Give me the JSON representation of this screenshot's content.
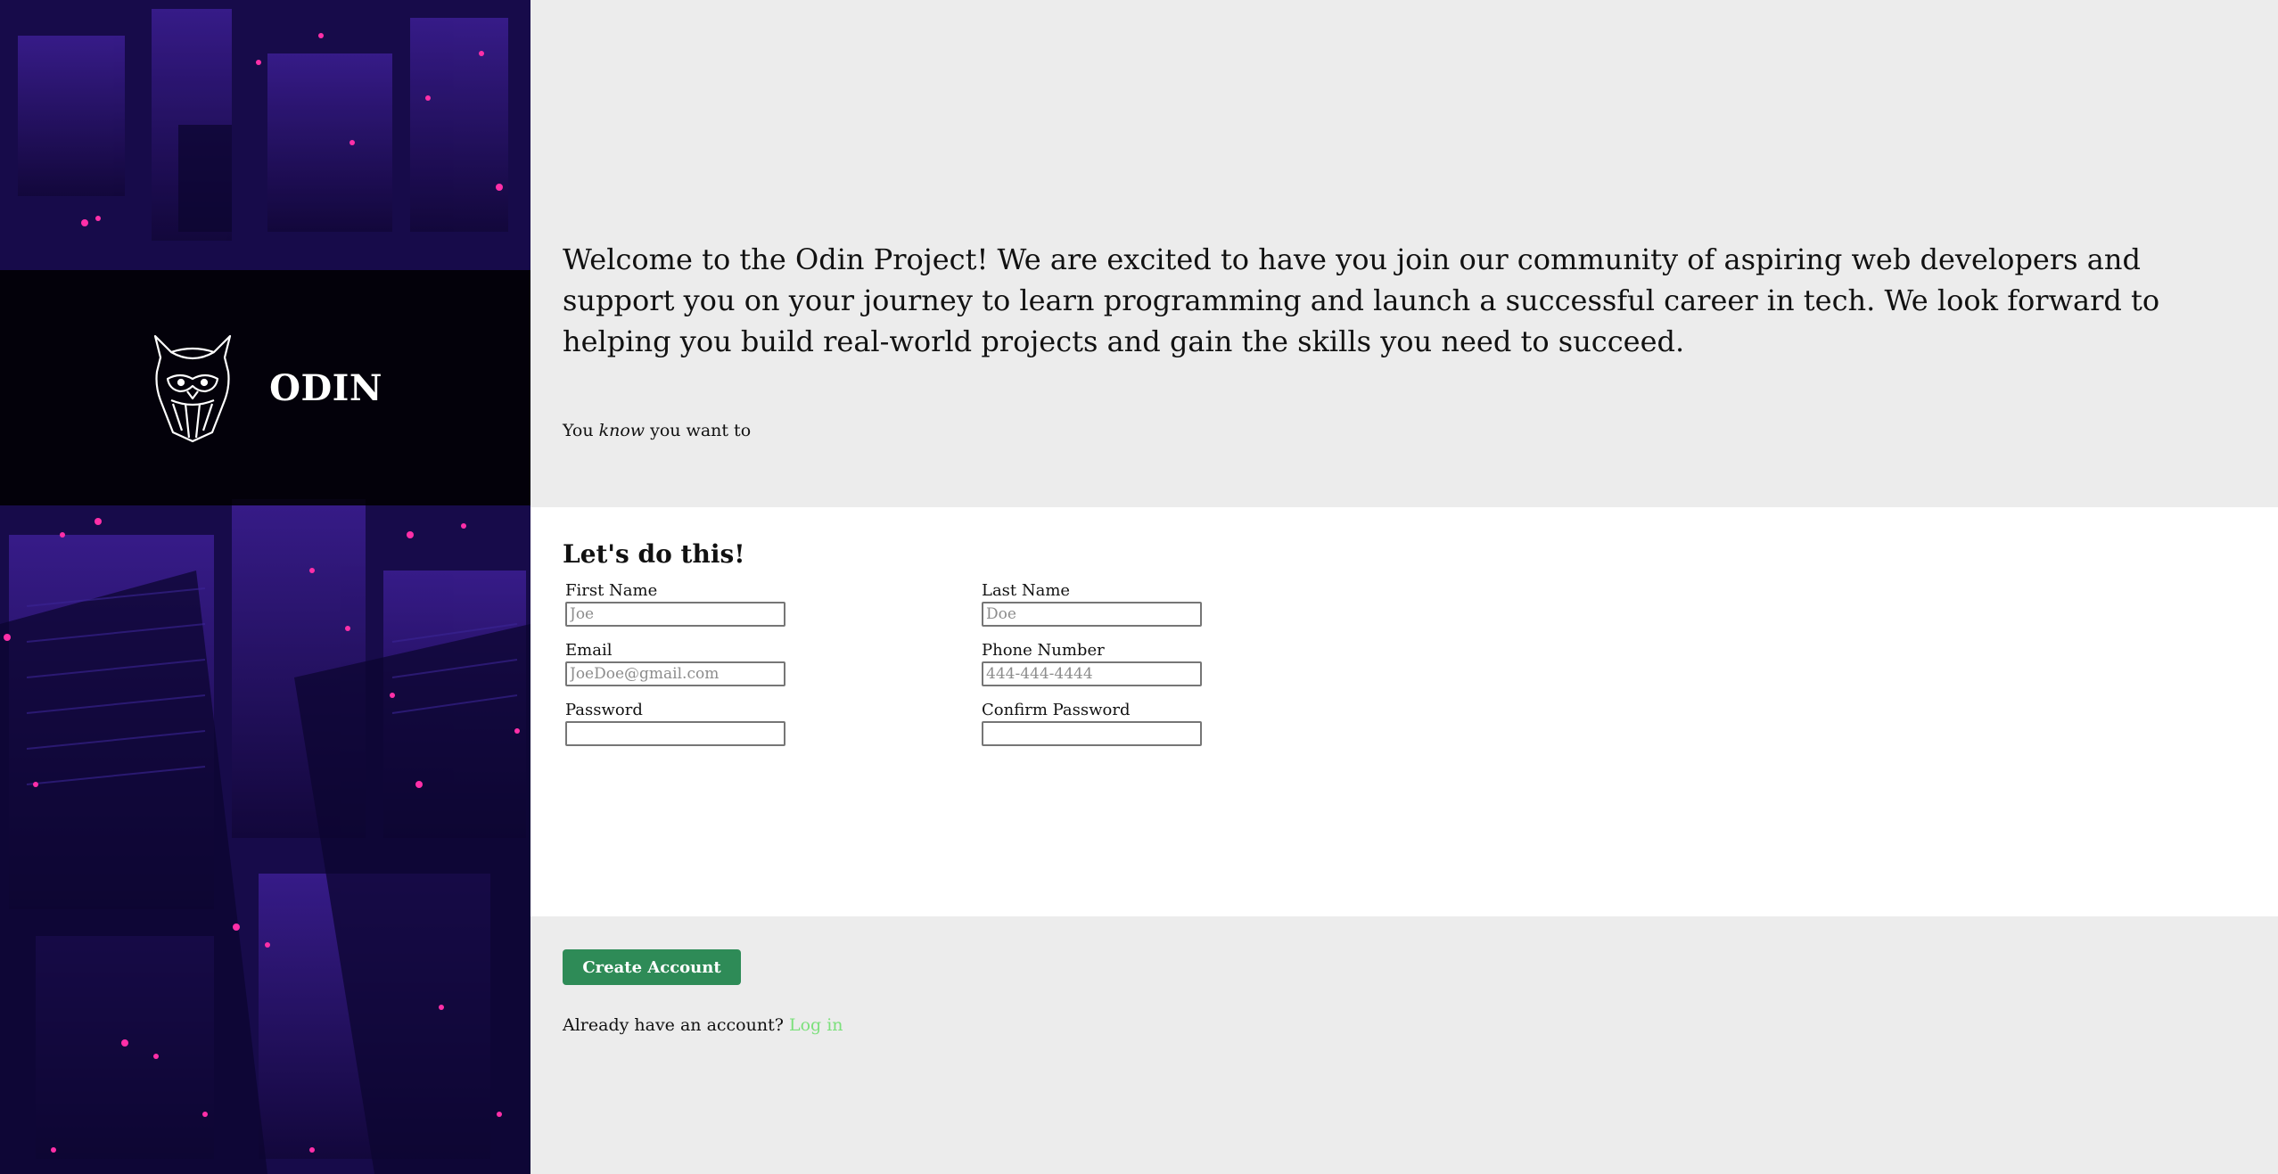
{
  "hero": {
    "brand": "ODIN",
    "logo_icon": "odin-viking-helmet-icon"
  },
  "intro": {
    "welcome": "Welcome to the Odin Project! We are excited to have you join our community of aspiring web developers and support you on your journey to learn programming and launch a successful career in tech. We look forward to helping you build real-world projects and gain the skills you need to succeed.",
    "tagline_before": "You ",
    "tagline_emphasis": "know",
    "tagline_after": " you want to"
  },
  "form": {
    "heading": "Let's do this!",
    "fields": {
      "first_name": {
        "label": "First Name",
        "placeholder": "Joe",
        "value": ""
      },
      "last_name": {
        "label": "Last Name",
        "placeholder": "Doe",
        "value": ""
      },
      "email": {
        "label": "Email",
        "placeholder": "JoeDoe@gmail.com",
        "value": ""
      },
      "phone": {
        "label": "Phone Number",
        "placeholder": "444-444-4444",
        "value": ""
      },
      "password": {
        "label": "Password",
        "placeholder": "",
        "value": ""
      },
      "confirm_password": {
        "label": "Confirm Password",
        "placeholder": "",
        "value": ""
      }
    }
  },
  "actions": {
    "create_account_label": "Create Account",
    "login_prompt": "Already have an account?",
    "login_link": "Log in"
  },
  "colors": {
    "button_bg": "#2e8b57",
    "link": "#7ce07c",
    "hero_purple": "#1a0c55",
    "page_bg": "#ececec"
  }
}
